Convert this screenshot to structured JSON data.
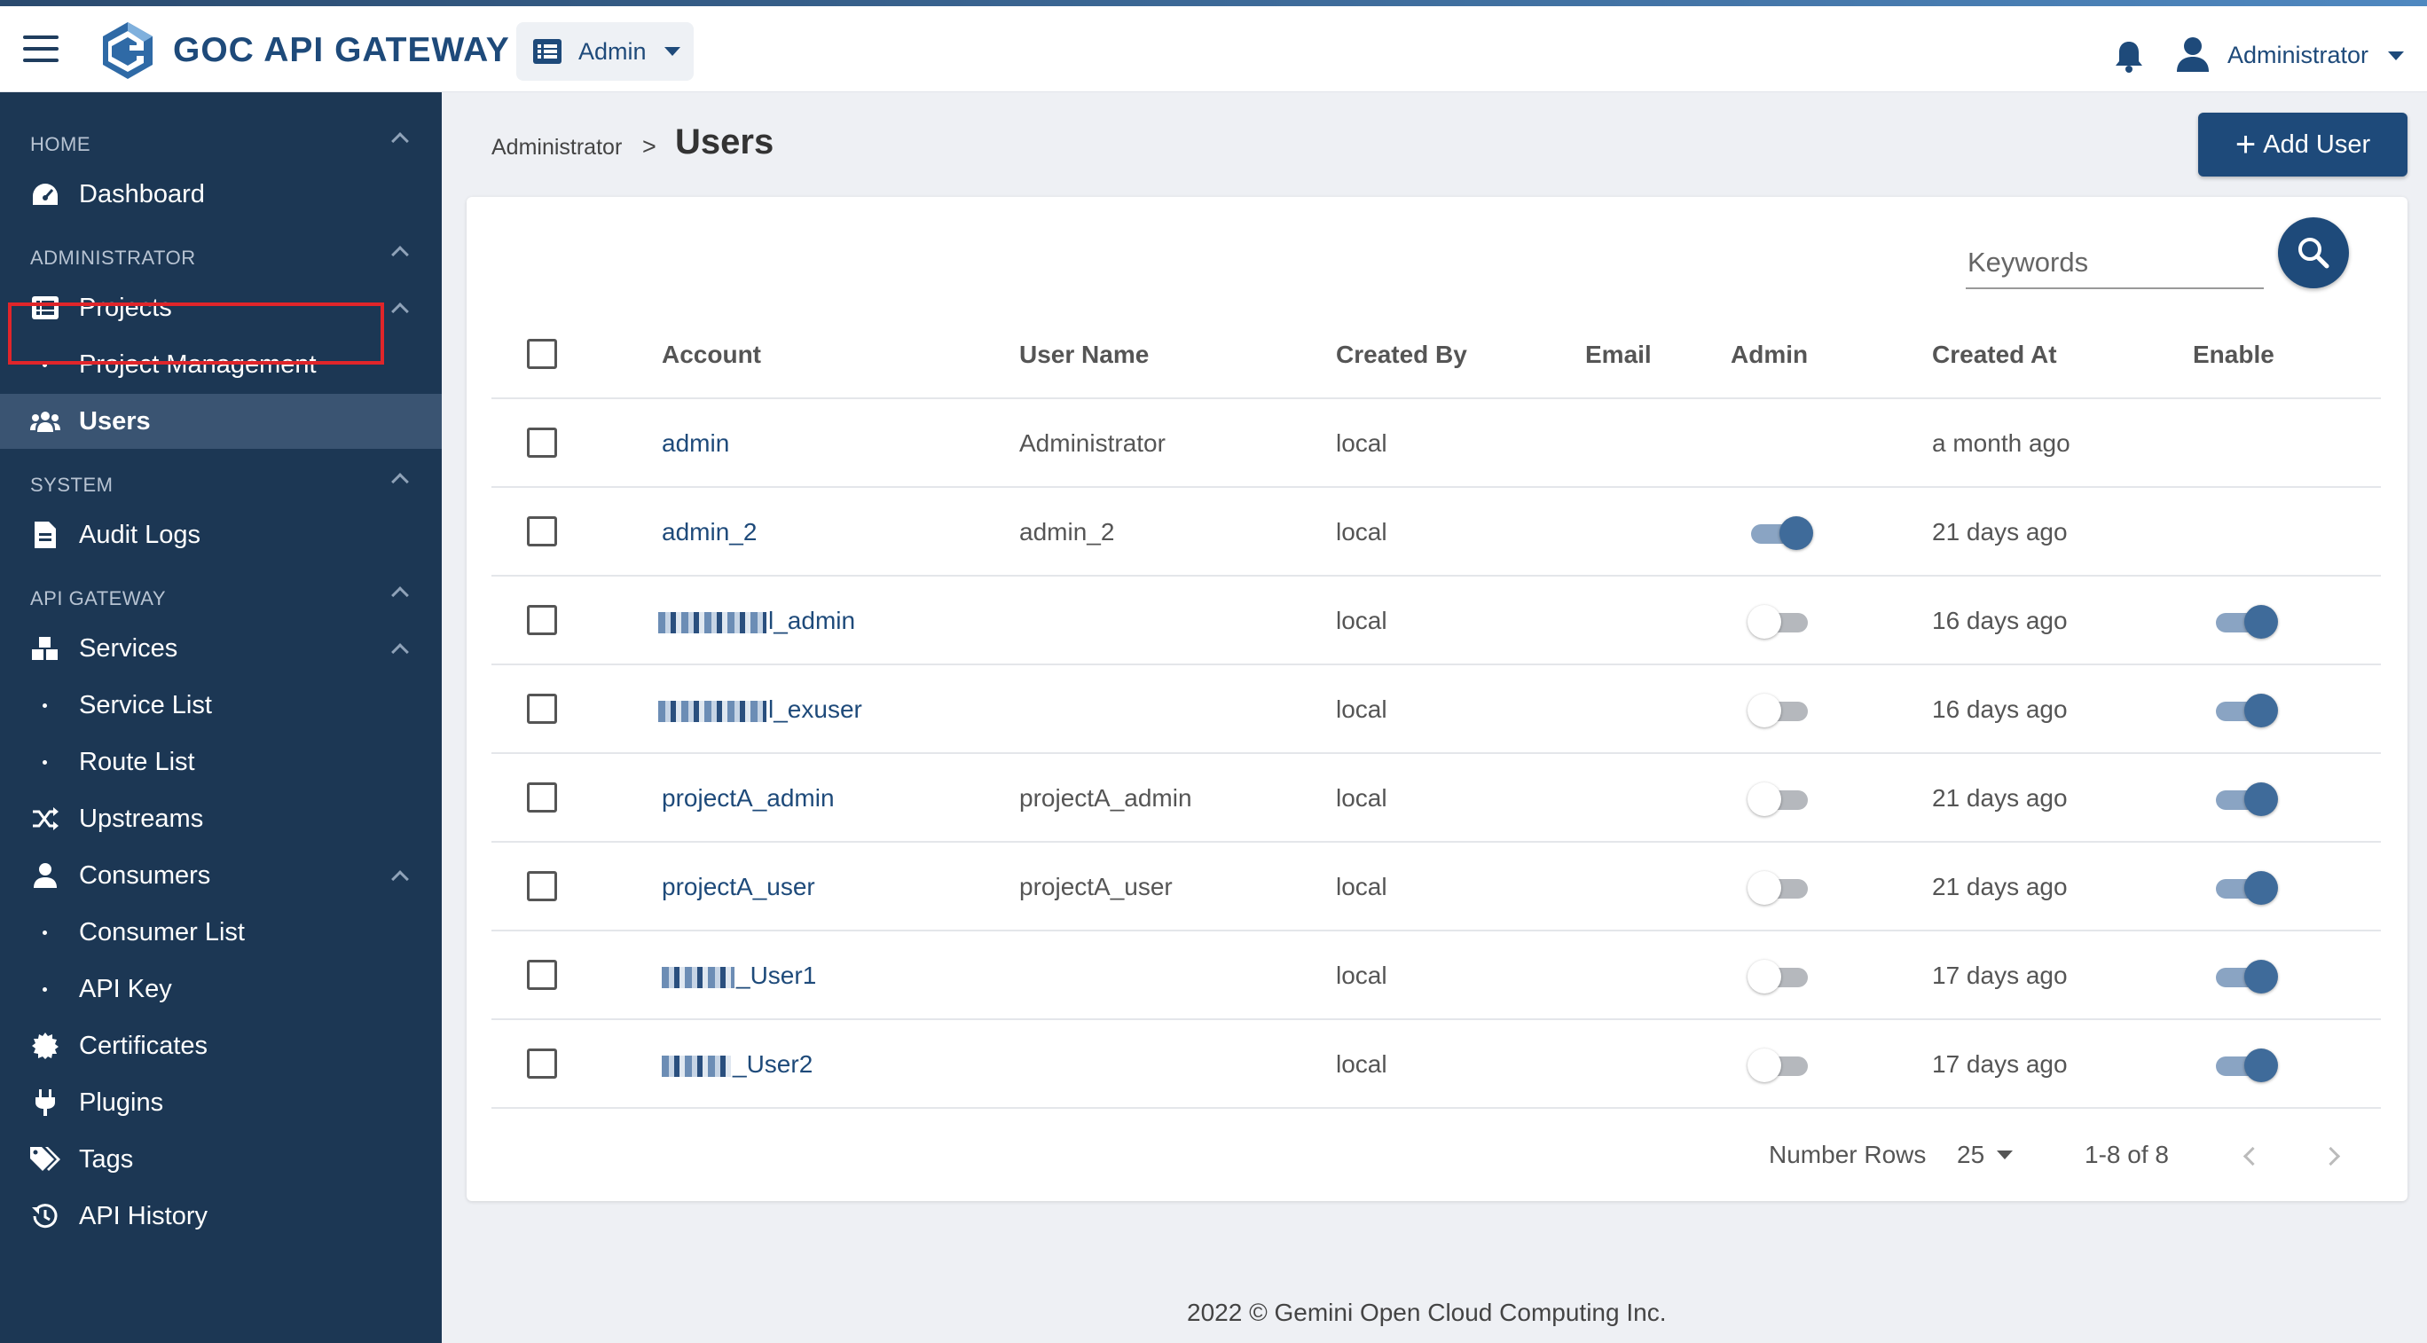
{
  "header": {
    "brand": "GOC API GATEWAY",
    "project_selector": "Admin",
    "user": "Administrator"
  },
  "sidebar": {
    "sections": {
      "home": "HOME",
      "administrator": "ADMINISTRATOR",
      "system": "SYSTEM",
      "api_gateway": "API GATEWAY"
    },
    "items": {
      "dashboard": "Dashboard",
      "projects": "Projects",
      "project_management": "Project Management",
      "users": "Users",
      "audit_logs": "Audit Logs",
      "services": "Services",
      "service_list": "Service List",
      "route_list": "Route List",
      "upstreams": "Upstreams",
      "consumers": "Consumers",
      "consumer_list": "Consumer List",
      "api_key": "API Key",
      "certificates": "Certificates",
      "plugins": "Plugins",
      "tags": "Tags",
      "api_history": "API History"
    }
  },
  "breadcrumb": {
    "parent": "Administrator",
    "separator": ">",
    "current": "Users"
  },
  "actions": {
    "add_user": "Add User"
  },
  "search": {
    "placeholder": "Keywords"
  },
  "table": {
    "columns": [
      "Account",
      "User Name",
      "Created By",
      "Email",
      "Admin",
      "Created At",
      "Enable"
    ],
    "rows": [
      {
        "account": "admin",
        "user_name": "Administrator",
        "created_by": "local",
        "email": "",
        "admin": null,
        "created_at": "a month ago",
        "enable": null
      },
      {
        "account": "admin_2",
        "user_name": "admin_2",
        "created_by": "local",
        "email": "",
        "admin": true,
        "created_at": "21 days ago",
        "enable": null
      },
      {
        "account": "l_admin",
        "user_name": "",
        "created_by": "local",
        "email": "",
        "admin": false,
        "created_at": "16 days ago",
        "enable": true
      },
      {
        "account": "l_exuser",
        "user_name": "",
        "created_by": "local",
        "email": "",
        "admin": false,
        "created_at": "16 days ago",
        "enable": true
      },
      {
        "account": "projectA_admin",
        "user_name": "projectA_admin",
        "created_by": "local",
        "email": "",
        "admin": false,
        "created_at": "21 days ago",
        "enable": true
      },
      {
        "account": "projectA_user",
        "user_name": "projectA_user",
        "created_by": "local",
        "email": "",
        "admin": false,
        "created_at": "21 days ago",
        "enable": true
      },
      {
        "account": "_User1",
        "user_name": "",
        "created_by": "local",
        "email": "",
        "admin": false,
        "created_at": "17 days ago",
        "enable": true
      },
      {
        "account": "_User2",
        "user_name": "",
        "created_by": "local",
        "email": "",
        "admin": false,
        "created_at": "17 days ago",
        "enable": true
      }
    ]
  },
  "pagination": {
    "label": "Number Rows",
    "rows_per_page": "25",
    "range": "1-8 of 8"
  },
  "footer": {
    "copyright": "2022 © Gemini Open Cloud Computing Inc."
  },
  "colors": {
    "primary": "#1e4a7a",
    "sidebar": "#1c3754",
    "highlight": "#e0252a"
  }
}
